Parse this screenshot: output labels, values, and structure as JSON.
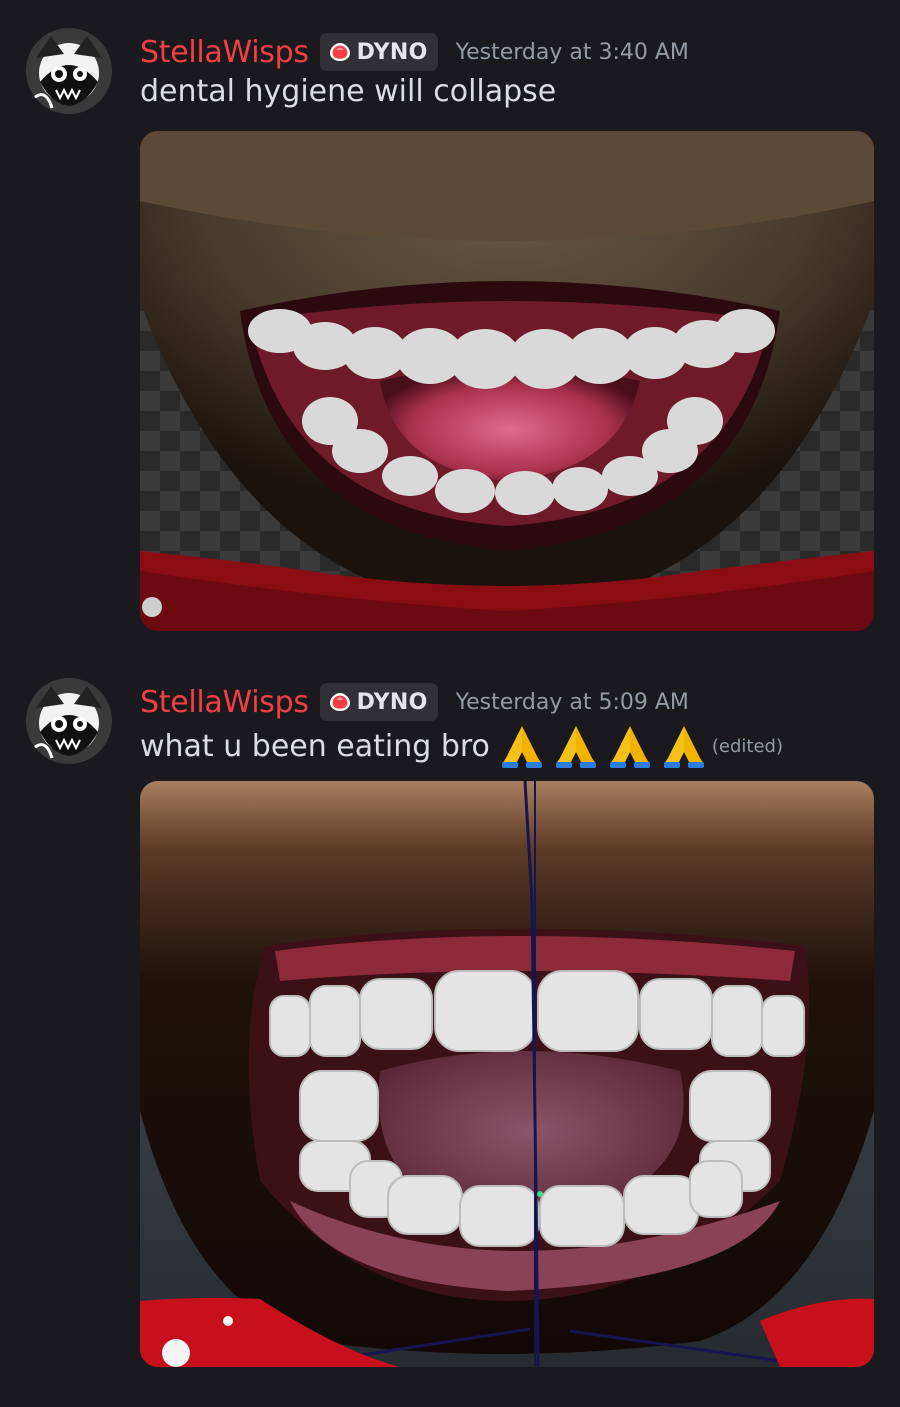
{
  "messages": [
    {
      "username": "StellaWisps",
      "role_tag": "DYNO",
      "timestamp": "Yesterday at 3:40 AM",
      "text": "dental hygiene will collapse",
      "emoji": [],
      "edited": "",
      "attachment_icon": "image-attachment"
    },
    {
      "username": "StellaWisps",
      "role_tag": "DYNO",
      "timestamp": "Yesterday at 5:09 AM",
      "text": "what u been eating bro",
      "emoji": [
        "🙏",
        "🙏",
        "🙏",
        "🙏"
      ],
      "edited": "(edited)",
      "attachment_icon": "image-attachment"
    }
  ],
  "colors": {
    "background": "#1a1a1e",
    "username": "#f23f43",
    "role_tag_bg": "#303036",
    "timestamp": "#949ba4",
    "message_text": "#dbdee1"
  },
  "icons": {
    "avatar": "avatar-icon",
    "role": "role-gem-icon",
    "emoji": "folded-hands-emoji"
  }
}
